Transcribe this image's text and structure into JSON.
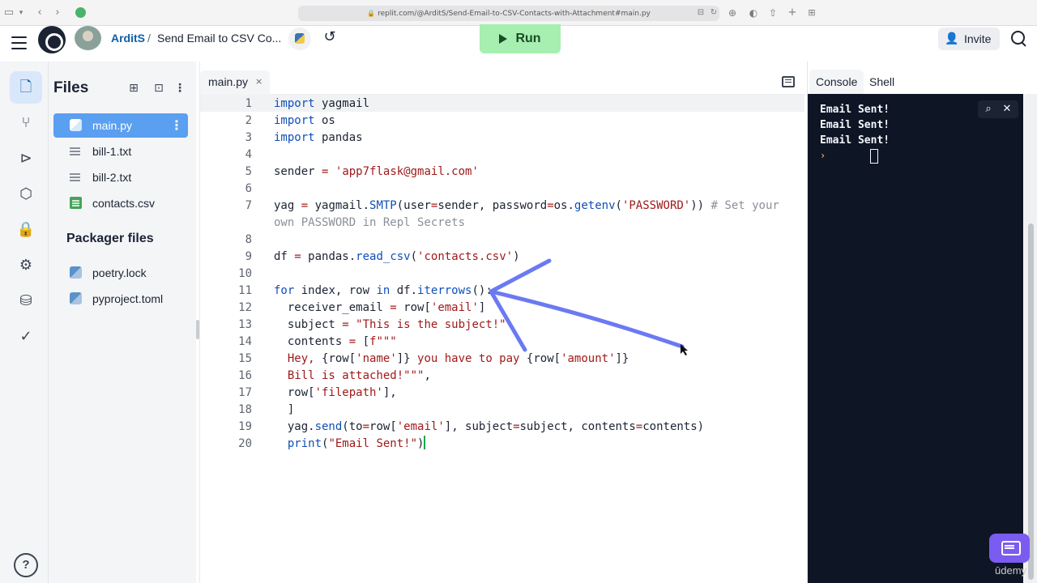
{
  "browser": {
    "url": "replit.com/@ArditS/Send-Email-to-CSV-Contacts-with-Attachment#main.py",
    "icons": [
      "sidebar-icon",
      "chevron-down-icon",
      "back-icon",
      "forward-icon",
      "favicon",
      "download-icon",
      "shield-icon",
      "share-icon",
      "plus-icon",
      "tabs-grid-icon"
    ]
  },
  "header": {
    "username": "ArditS",
    "separator": "/",
    "repl_name": "Send Email to CSV Co...",
    "run_label": "Run",
    "invite_label": "Invite"
  },
  "rail": {
    "items": [
      "files-icon",
      "git-icon",
      "debugger-icon",
      "packages-icon",
      "secrets-icon",
      "settings-icon",
      "database-icon",
      "check-icon"
    ],
    "help_label": "?"
  },
  "files": {
    "title": "Files",
    "items": [
      {
        "label": "main.py",
        "icon": "python-icon",
        "active": true
      },
      {
        "label": "bill-1.txt",
        "icon": "text-file-icon"
      },
      {
        "label": "bill-2.txt",
        "icon": "text-file-icon"
      },
      {
        "label": "contacts.csv",
        "icon": "csv-icon"
      }
    ],
    "packager_title": "Packager files",
    "packager_items": [
      {
        "label": "poetry.lock",
        "icon": "python-icon"
      },
      {
        "label": "pyproject.toml",
        "icon": "python-icon"
      }
    ]
  },
  "editor": {
    "tab_label": "main.py",
    "tab_close": "×",
    "line_numbers": [
      "1",
      "2",
      "3",
      "4",
      "5",
      "6",
      "7",
      "",
      "8",
      "9",
      "10",
      "11",
      "12",
      "13",
      "14",
      "15",
      "16",
      "17",
      "18",
      "19",
      "20"
    ]
  },
  "console": {
    "tabs": [
      "Console",
      "Shell"
    ],
    "lines": [
      "Email Sent!",
      "Email Sent!",
      "Email Sent!"
    ],
    "prompt": "›"
  },
  "watermark": "ūdemy",
  "colors": {
    "run_green": "#a6efb0",
    "accent_blue": "#5a9ff0",
    "console_bg": "#0e1525",
    "annotation_arrow": "#5b6cf0",
    "chat_purple": "#7a5cf0"
  }
}
